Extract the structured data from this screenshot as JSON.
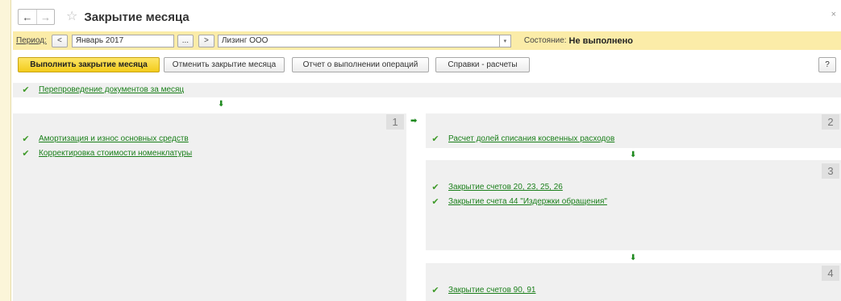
{
  "window": {
    "title": "Закрытие месяца",
    "back_icon": "←",
    "forward_icon": "→",
    "star_icon": "☆",
    "close_icon": "×"
  },
  "period_bar": {
    "period_label": "Период:",
    "prev_label": "<",
    "period_value": "Январь 2017",
    "ellipsis_label": "...",
    "next_label": ">",
    "organization_value": "Лизинг ООО",
    "dropdown_icon": "▾",
    "state_label": "Состояние:",
    "state_value": "Не выполнено"
  },
  "toolbar": {
    "run_label": "Выполнить закрытие месяца",
    "cancel_label": "Отменить закрытие месяца",
    "report_label": "Отчет о выполнении операций",
    "help_calc_label": "Справки - расчеты",
    "help_label": "?"
  },
  "process": {
    "check_icon": "✔",
    "arrow_down_icon": "⬇",
    "arrow_right_icon": "➡",
    "top_step": "Перепроведение документов за месяц",
    "block1": {
      "number": "1",
      "items": [
        "Амортизация и износ основных средств",
        "Корректировка стоимости номенклатуры"
      ]
    },
    "block2": {
      "number": "2",
      "items": [
        "Расчет долей списания косвенных расходов"
      ]
    },
    "block3": {
      "number": "3",
      "items": [
        "Закрытие счетов 20, 23, 25, 26",
        "Закрытие счета 44 \"Издержки обращения\""
      ]
    },
    "block4": {
      "number": "4",
      "items": [
        "Закрытие счетов 90, 91"
      ]
    }
  }
}
